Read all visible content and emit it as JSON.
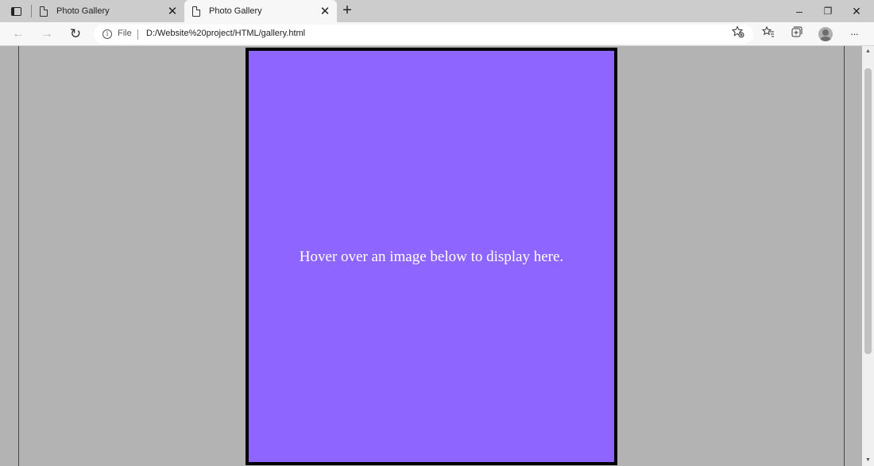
{
  "browser": {
    "tabs": [
      {
        "title": "Photo Gallery",
        "active": false
      },
      {
        "title": "Photo Gallery",
        "active": true
      }
    ],
    "new_tab_label": "+",
    "window_controls": {
      "minimize": "–",
      "restore": "❐",
      "close": "✕"
    },
    "nav": {
      "back": "←",
      "forward": "→",
      "reload": "↻"
    },
    "address": {
      "scheme_label": "File",
      "url": "D:/Website%20project/HTML/gallery.html"
    },
    "toolbar_icons": [
      "favorites-add-icon",
      "favorites-icon",
      "collections-icon",
      "profile-icon",
      "more-menu-icon"
    ],
    "more_label": "···"
  },
  "page": {
    "display_text": "Hover over an image below to display here.",
    "display_color": "#8e66ff",
    "background_color": "#b3b3b3"
  }
}
